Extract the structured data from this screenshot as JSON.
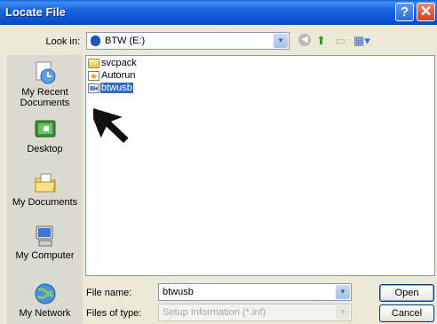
{
  "window": {
    "title": "Locate File"
  },
  "lookin": {
    "label": "Look in:",
    "value": "BTW (E:)"
  },
  "toolbar": {
    "back_icon": "back-arrow-icon",
    "up_icon": "up-folder-icon",
    "newfolder_icon": "new-folder-icon",
    "views_icon": "views-menu-icon"
  },
  "places": [
    {
      "label": "My Recent Documents",
      "icon": "recent-documents-icon"
    },
    {
      "label": "Desktop",
      "icon": "desktop-icon"
    },
    {
      "label": "My Documents",
      "icon": "my-documents-icon"
    },
    {
      "label": "My Computer",
      "icon": "my-computer-icon"
    },
    {
      "label": "My Network",
      "icon": "my-network-icon"
    }
  ],
  "files": [
    {
      "name": "svcpack",
      "icon": "folder-icon",
      "selected": false
    },
    {
      "name": "Autorun",
      "icon": "autorun-file-icon",
      "selected": false
    },
    {
      "name": "btwusb",
      "icon": "setup-info-file-icon",
      "selected": true
    }
  ],
  "filename": {
    "label": "File name:",
    "value": "btwusb"
  },
  "filetype": {
    "label": "Files of type:",
    "value": "Setup Information (*.inf)"
  },
  "buttons": {
    "open": "Open",
    "cancel": "Cancel"
  },
  "colors": {
    "titlebar": "#0b4fd1",
    "selection": "#316ac5",
    "dialog_bg": "#ece9d8"
  }
}
